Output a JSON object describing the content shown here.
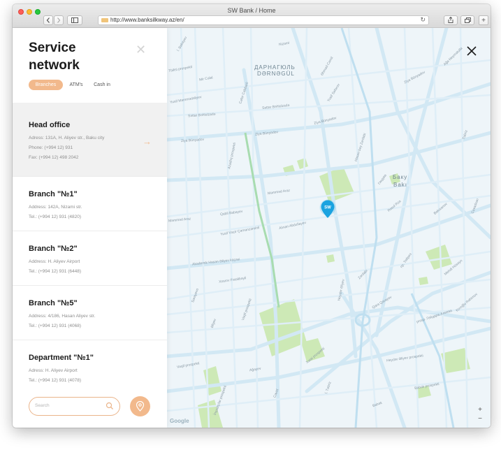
{
  "window": {
    "title": "SW Bank  /  Home",
    "url": "http://www.banksilkway.az/en/"
  },
  "sidebar": {
    "title": "Service network",
    "tabs": [
      {
        "label": "Branches",
        "active": true
      },
      {
        "label": "ATM's",
        "active": false
      },
      {
        "label": "Cash in",
        "active": false
      }
    ],
    "offices": [
      {
        "name": "Head office",
        "lines": [
          "Adress: 131A, H. Aliyev str., Baku city",
          "Phone: (+994 12) 931",
          "Fax: (+994 12) 498 2042"
        ],
        "highlighted": true
      },
      {
        "name": "Branch \"№1\"",
        "lines": [
          "Address: 142A, Nizami str.",
          "Tel.: (+994 12) 931 (4820)"
        ],
        "highlighted": false
      },
      {
        "name": "Branch \"№2\"",
        "lines": [
          "Address: H. Aliyev Airport",
          "Tel.: (+994 12) 931 (6448)"
        ],
        "highlighted": false
      },
      {
        "name": "Branch \"№5\"",
        "lines": [
          "Address: 4/186, Hasan Aliyev str.",
          "Tel.: (+994 12) 931 (4068)"
        ],
        "highlighted": false
      },
      {
        "name": "Department \"№1\"",
        "lines": [
          "Adress: H. Aliyev Airport",
          "Tel.: (+994 12) 931 (4078)"
        ],
        "highlighted": false
      }
    ],
    "search_placeholder": "Search"
  },
  "map": {
    "districts": [
      {
        "name": "ДАРНАГЮЛЬ"
      },
      {
        "name": "DƏRNƏGÜL"
      },
      {
        "name": "Баку"
      },
      {
        "name": "Bakı"
      }
    ],
    "streets": [
      {
        "name": "Ziya Bünyadov"
      },
      {
        "name": "Ziya Bünyadov"
      },
      {
        "name": "Ziya Bünyadov"
      },
      {
        "name": "Ziya Bünyadov"
      },
      {
        "name": "Səttar Bəhlulzadə"
      },
      {
        "name": "Səttar Bəhlulzadə"
      },
      {
        "name": "Məmməd Araz"
      },
      {
        "name": "Məmməd Araz"
      },
      {
        "name": "Akademik Həsən Əliyev küçəsi"
      },
      {
        "name": "Alıxan Abdullayev"
      },
      {
        "name": "Xətai prospekti"
      },
      {
        "name": "Heydər Əliyev prospekti"
      },
      {
        "name": "Vaqif prospekti"
      },
      {
        "name": "Vaqif prospekti"
      },
      {
        "name": "Qabil Babayev"
      },
      {
        "name": "Yusif Vəzir Çəmənzəminli"
      },
      {
        "name": "Xosrov Fətəlibəyli"
      },
      {
        "name": "Cəfər Cabbarlı"
      },
      {
        "name": "İnşaatçılar prospekti"
      },
      {
        "name": "Babək prospekti"
      },
      {
        "name": "Babək"
      },
      {
        "name": "prosp. Гейдара Алиева"
      },
      {
        "name": "пр. Тебриз"
      },
      {
        "name": "Гянджа"
      },
      {
        "name": "Heydər Əliyev"
      },
      {
        "name": "İ. Təbriz"
      },
      {
        "name": "Əhməd Cəmil"
      },
      {
        "name": "Yusif Səfərov"
      },
      {
        "name": "Mir Cəlal"
      },
      {
        "name": "Təbriz"
      },
      {
        "name": "Həsən bəy Zərdabi"
      },
      {
        "name": "Ağa Neymətulla"
      },
      {
        "name": "Azadlıq prospekti"
      },
      {
        "name": "Sarayevo"
      },
      {
        "name": "Bakıxanov"
      },
      {
        "name": "Rəsul Rza"
      },
      {
        "name": "Tbilisi prospekti"
      },
      {
        "name": "Mehdi Hüseyn"
      },
      {
        "name": "Zərdabi"
      },
      {
        "name": "Cavadxan"
      },
      {
        "name": "İ. Babayev"
      },
      {
        "name": "Yusif Məmmədəliyev"
      },
      {
        "name": "Nizami"
      },
      {
        "name": "Ağayev"
      },
      {
        "name": "Qara Qarayev"
      },
      {
        "name": "Əliyev"
      },
      {
        "name": "Koroğlu Rəhimov"
      },
      {
        "name": "Cavid"
      }
    ],
    "pin_label": "SW",
    "zoom_in": "+",
    "zoom_out": "−",
    "attribution": "Google"
  },
  "colors": {
    "accent": "#f2b98c",
    "map_bg": "#eef5f9",
    "road": "#cfe6f2",
    "park": "#cde9b6",
    "pin": "#1ba3e0"
  }
}
